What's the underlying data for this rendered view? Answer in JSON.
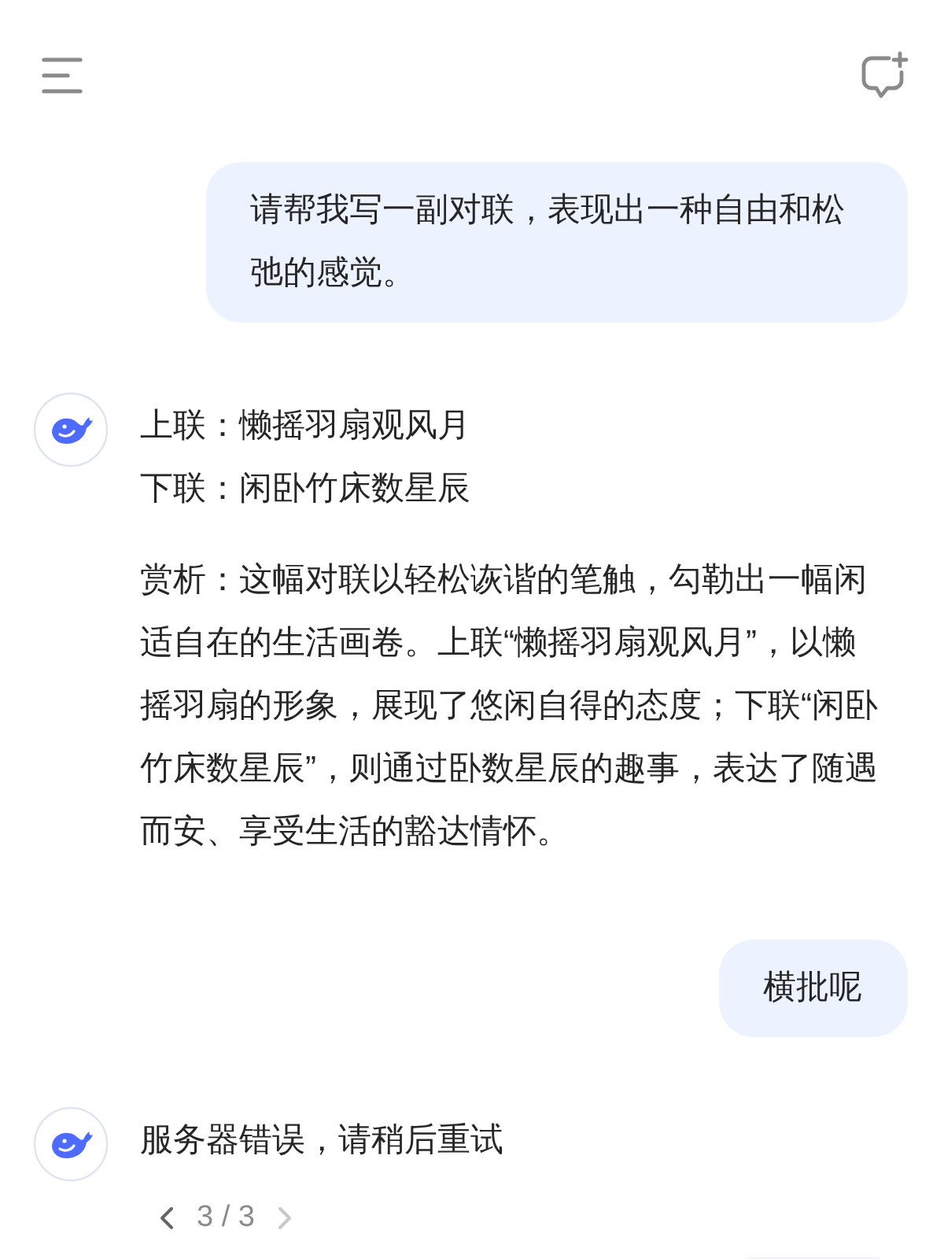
{
  "messages": [
    {
      "kind": "user",
      "text": "请帮我写一副对联，表现出一种自由和松弛的感觉。"
    },
    {
      "kind": "assistant",
      "blocks": [
        {
          "lines": [
            "上联：懒摇羽扇观风月",
            "下联：闲卧竹床数星辰"
          ]
        },
        {
          "lines": [
            "赏析：这幅对联以轻松诙谐的笔触，勾勒出一幅闲适自在的生活画卷。上联“懒摇羽扇观风月”，以懒摇羽扇的形象，展现了悠闲自得的态度；下联“闲卧竹床数星辰”，则通过卧数星辰的趣事，表达了随遇而安、享受生活的豁达情怀。"
          ]
        }
      ]
    },
    {
      "kind": "user",
      "text": "横批呢"
    },
    {
      "kind": "assistant",
      "blocks": [
        {
          "lines": [
            "服务器错误，请稍后重试"
          ]
        }
      ],
      "pager": {
        "text": "3 / 3",
        "prev_disabled": false,
        "next_disabled": true
      }
    },
    {
      "kind": "user"
    }
  ]
}
